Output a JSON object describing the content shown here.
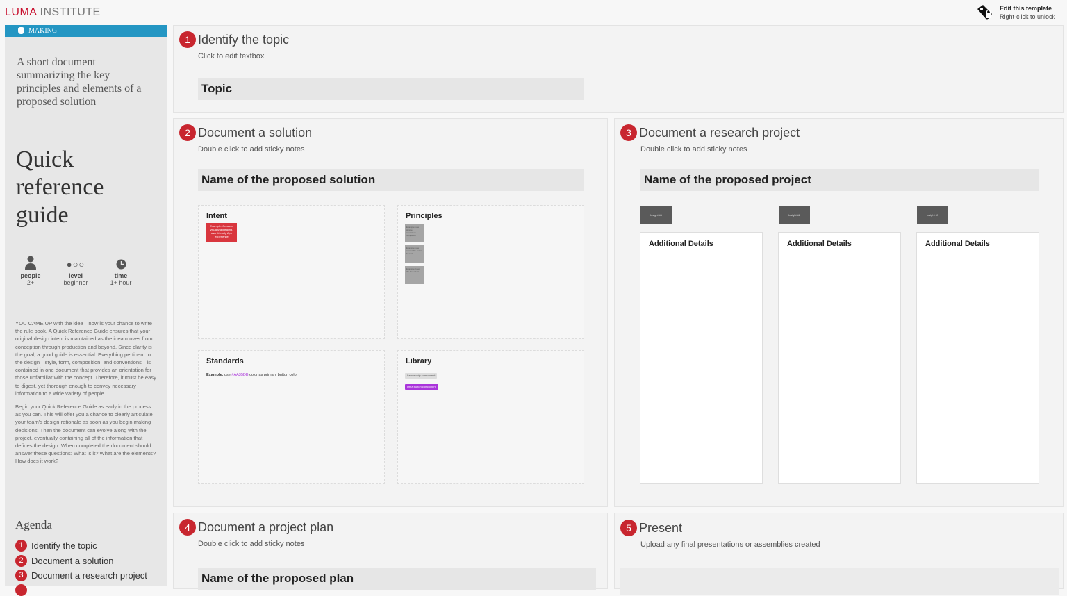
{
  "header": {
    "logo_primary": "LUMA",
    "logo_secondary": " INSTITUTE",
    "edit_title": "Edit this template",
    "edit_hint": "Right-click to unlock",
    "edit_icon": "lock-tag-icon"
  },
  "sidebar": {
    "category": "MAKING",
    "category_icon": "hand-icon",
    "description": "A short document summarizing the key principles and elements of a proposed solution",
    "title": "Quick reference guide",
    "meta": [
      {
        "icon": "person-icon",
        "key": "people",
        "value": "2+"
      },
      {
        "icon": "level-dots-icon",
        "key": "level",
        "value": "beginner",
        "dots": "●○○"
      },
      {
        "icon": "clock-icon",
        "key": "time",
        "value": "1+ hour"
      }
    ],
    "body": [
      "YOU CAME UP with the idea—now is your chance to write the rule book. A Quick Reference Guide ensures that your original design intent is maintained as the idea moves from conception through production and beyond. Since clarity is the goal, a good guide is essential. Everything pertinent to the design—style, form, composition, and conventions—is contained in one document that provides an orientation for those unfamiliar with the concept. Therefore, it must be easy to digest, yet thorough enough to convey necessary information to a wide variety of people.",
      "Begin your Quick Reference Guide as early in the process as you can. This will offer you a chance to clearly articulate your team's design rationale as soon as you begin making decisions. Then the document can evolve along with the project, eventually containing all of the information that defines the design. When completed the document should answer these questions: What is it? What are the elements? How does it work?"
    ],
    "agenda_title": "Agenda",
    "agenda": [
      {
        "num": "1",
        "label": "Identify the topic"
      },
      {
        "num": "2",
        "label": "Document a solution"
      },
      {
        "num": "3",
        "label": "Document a research project"
      }
    ]
  },
  "sections": {
    "s1": {
      "num": "1",
      "title": "Identify the topic",
      "subtitle": "Click to edit textbox",
      "name": "Topic"
    },
    "s2": {
      "num": "2",
      "title": "Document a solution",
      "subtitle": "Double click to add sticky notes",
      "name": "Name of the proposed solution",
      "cards": {
        "intent": {
          "label": "Intent",
          "sticky": "Example: Create a visually appealing, user-friendly App experience"
        },
        "principles": {
          "label": "Principles",
          "stickies": [
            "Example: use simple, consistent navigation",
            "Example: use accessible colors for text",
            "Example: keep the flow short"
          ]
        },
        "standards": {
          "label": "Standards",
          "example_label": "Example:",
          "example_pre": " use ",
          "example_color": "#AA35DB",
          "example_post": " color as primary button color"
        },
        "library": {
          "label": "Library",
          "chip1": "I am a chip component",
          "chip2": "I'm a button component"
        }
      }
    },
    "s3": {
      "num": "3",
      "title": "Document a research project",
      "subtitle": "Double click to add sticky notes",
      "name": "Name of the proposed project",
      "columns": [
        {
          "insight": "Insight #1",
          "label": "Additional Details"
        },
        {
          "insight": "Insight #2",
          "label": "Additional Details"
        },
        {
          "insight": "Insight #3",
          "label": "Additional Details"
        }
      ]
    },
    "s4": {
      "num": "4",
      "title": "Document a project plan",
      "subtitle": "Double click to add sticky notes",
      "name": "Name of the proposed plan"
    },
    "s5": {
      "num": "5",
      "title": "Present",
      "subtitle": "Upload any final presentations or assemblies created"
    }
  },
  "colors": {
    "accent_red": "#c8262f",
    "making_blue": "#2496c3",
    "purple": "#aa35db",
    "intent_red": "#d9363e"
  }
}
